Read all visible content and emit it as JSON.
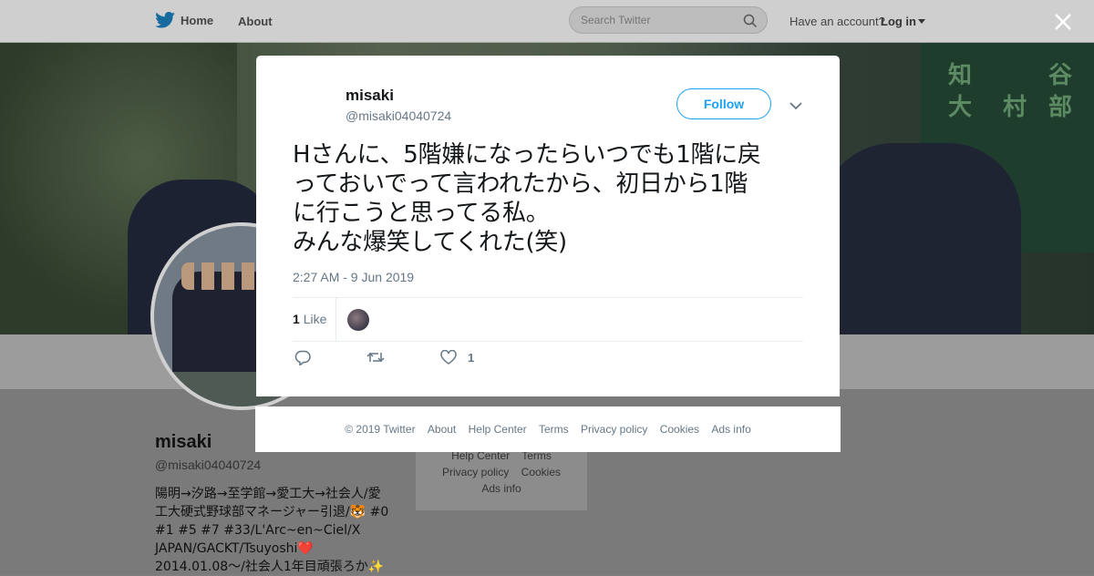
{
  "nav": {
    "home_label": "Home",
    "about_label": "About",
    "search_placeholder": "Search Twitter",
    "account_prompt": "Have an account?",
    "login_label": "Log in"
  },
  "banner": {
    "scoreboard_chars": [
      "知",
      "大",
      "村",
      "部",
      "谷"
    ]
  },
  "profile": {
    "name": "misaki",
    "handle": "@misaki04040724",
    "bio": "陽明→汐路→至学館→愛工大→社会人/愛\n工大硬式野球部マネージャー引退/🐯 #0\n#1 #5 #7 #33/L'Arc~en~Ciel/X\nJAPAN/GACKT/Tsuyoshi❤️\n2014.01.08〜/社会人1年目頑張ろか✨",
    "side_links": {
      "help_center": "Help Center",
      "terms": "Terms",
      "privacy": "Privacy policy",
      "cookies": "Cookies",
      "ads": "Ads info"
    }
  },
  "tweet": {
    "author_name": "misaki",
    "author_handle": "@misaki04040724",
    "follow_label": "Follow",
    "text": "Hさんに、5階嫌になったらいつでも1階に戻\nっておいでって言われたから、初日から1階\nに行こうと思ってる私。\nみんな爆笑してくれた(笑)",
    "timestamp": "2:27 AM - 9 Jun 2019",
    "like_count": "1",
    "like_word": "Like",
    "action_like_count": "1"
  },
  "footer": {
    "copyright": "© 2019 Twitter",
    "about": "About",
    "help_center": "Help Center",
    "terms": "Terms",
    "privacy": "Privacy policy",
    "cookies": "Cookies",
    "ads": "Ads info"
  },
  "colors": {
    "brand_blue": "#1da1f2",
    "text_dark": "#14171a",
    "text_muted": "#657786",
    "overlay_gray": "#7d7d7d"
  }
}
